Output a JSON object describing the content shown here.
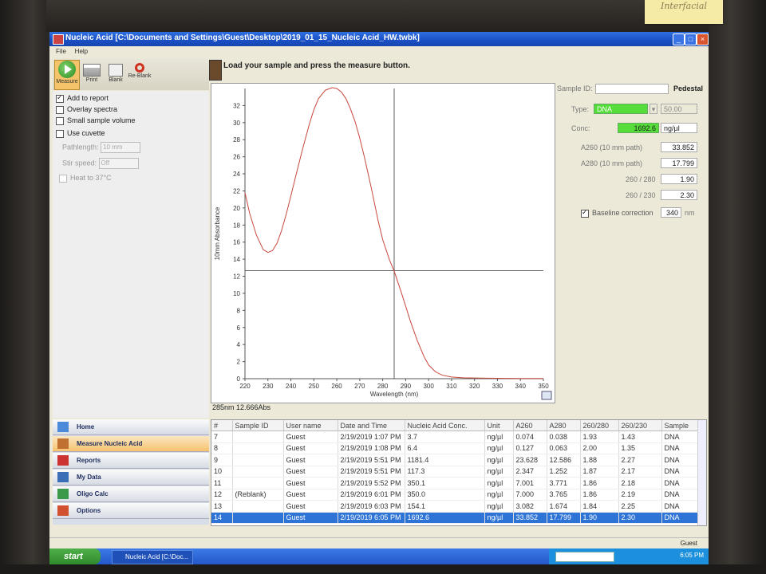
{
  "window": {
    "title": "Nucleic Acid  [C:\\Documents and Settings\\Guest\\Desktop\\2019_01_15_Nucleic Acid_HW.twbk]"
  },
  "menu": [
    "File",
    "Help"
  ],
  "sticky_note": "Interfacial",
  "toolbar": {
    "measure": "Measure",
    "print": "Print",
    "blank": "Blank",
    "reblank": "Re-Blank"
  },
  "prompt": "Load your sample and press the measure button.",
  "options": {
    "add_to_report": "Add to report",
    "overlay_spectra": "Overlay spectra",
    "small_sample": "Small sample volume",
    "use_cuvette": "Use cuvette",
    "pathlength_label": "Pathlength:",
    "pathlength_value": "10 mm",
    "stir_label": "Stir speed:",
    "stir_value": "Off",
    "heat": "Heat to 37°C"
  },
  "nav": [
    "Home",
    "Measure Nucleic Acid",
    "Reports",
    "My Data",
    "Oligo Calc",
    "Options"
  ],
  "sample": {
    "sample_id_label": "Sample ID:",
    "pedestal": "Pedestal",
    "type_label": "Type:",
    "type_value": "DNA",
    "type_factor": "50.00",
    "conc_label": "Conc:",
    "conc_value": "1692.6",
    "conc_unit": "ng/µl",
    "a260_label": "A260 (10 mm path)",
    "a260_value": "33.852",
    "a280_label": "A280 (10 mm path)",
    "a280_value": "17.799",
    "r260_280_label": "260 / 280",
    "r260_280_value": "1.90",
    "r260_230_label": "260 / 230",
    "r260_230_value": "2.30",
    "baseline_label": "Baseline correction",
    "baseline_value": "340",
    "baseline_unit": "nm"
  },
  "readout": "285nm 12.666Abs",
  "chart_data": {
    "type": "line",
    "xlabel": "Wavelength (nm)",
    "ylabel": "10mm Absorbance",
    "xlim": [
      220,
      350
    ],
    "ylim": [
      0,
      34
    ],
    "xticks": [
      220,
      230,
      240,
      250,
      260,
      270,
      280,
      290,
      300,
      310,
      320,
      330,
      340,
      350
    ],
    "yticks": [
      0,
      2,
      4,
      6,
      8,
      10,
      12,
      14,
      16,
      18,
      20,
      22,
      24,
      26,
      28,
      30,
      32
    ],
    "cursor": {
      "x": 285,
      "y": 12.666
    },
    "series": [
      {
        "color": "#c8483c",
        "x": [
          220,
          222,
          225,
          228,
          230,
          232,
          234,
          236,
          238,
          240,
          242,
          245,
          248,
          250,
          252,
          255,
          258,
          260,
          262,
          264,
          266,
          268,
          270,
          272,
          275,
          278,
          280,
          283,
          285,
          288,
          290,
          292,
          295,
          298,
          300,
          303,
          306,
          310,
          315,
          320,
          325,
          330,
          335,
          340,
          345,
          350
        ],
        "y": [
          21.8,
          19.4,
          16.8,
          15.1,
          14.8,
          15.0,
          15.9,
          17.4,
          19.3,
          21.4,
          23.6,
          26.8,
          29.8,
          31.5,
          32.8,
          33.8,
          34.1,
          34.0,
          33.6,
          32.8,
          31.6,
          30.1,
          28.2,
          26.0,
          22.4,
          18.5,
          16.3,
          13.9,
          12.6,
          10.2,
          8.5,
          6.8,
          4.5,
          2.6,
          1.6,
          0.8,
          0.4,
          0.2,
          0.1,
          0.08,
          0.06,
          0.05,
          0.04,
          0.03,
          0.02,
          0.02
        ]
      }
    ]
  },
  "table": {
    "columns": [
      "#",
      "Sample ID",
      "User name",
      "Date and Time",
      "Nucleic Acid Conc.",
      "Unit",
      "A260",
      "A280",
      "260/280",
      "260/230",
      "Sample"
    ],
    "rows": [
      [
        "7",
        "",
        "Guest",
        "2/19/2019 1:07 PM",
        "3.7",
        "ng/µl",
        "0.074",
        "0.038",
        "1.93",
        "1.43",
        "DNA"
      ],
      [
        "8",
        "",
        "Guest",
        "2/19/2019 1:08 PM",
        "6.4",
        "ng/µl",
        "0.127",
        "0.063",
        "2.00",
        "1.35",
        "DNA"
      ],
      [
        "9",
        "",
        "Guest",
        "2/19/2019 5:51 PM",
        "1181.4",
        "ng/µl",
        "23.628",
        "12.586",
        "1.88",
        "2.27",
        "DNA"
      ],
      [
        "10",
        "",
        "Guest",
        "2/19/2019 5:51 PM",
        "117.3",
        "ng/µl",
        "2.347",
        "1.252",
        "1.87",
        "2.17",
        "DNA"
      ],
      [
        "11",
        "",
        "Guest",
        "2/19/2019 5:52 PM",
        "350.1",
        "ng/µl",
        "7.001",
        "3.771",
        "1.86",
        "2.18",
        "DNA"
      ],
      [
        "12",
        "(Reblank)",
        "Guest",
        "2/19/2019 6:01 PM",
        "350.0",
        "ng/µl",
        "7.000",
        "3.765",
        "1.86",
        "2.19",
        "DNA"
      ],
      [
        "13",
        "",
        "Guest",
        "2/19/2019 6:03 PM",
        "154.1",
        "ng/µl",
        "3.082",
        "1.674",
        "1.84",
        "2.25",
        "DNA"
      ],
      [
        "14",
        "",
        "Guest",
        "2/19/2019 6:05 PM",
        "1692.6",
        "ng/µl",
        "33.852",
        "17.799",
        "1.90",
        "2.30",
        "DNA"
      ]
    ],
    "selected_row": 7
  },
  "status_user": "Guest",
  "taskbar": {
    "start": "start",
    "task": "Nucleic Acid  [C:\\Doc...",
    "clock": "6:05 PM"
  }
}
